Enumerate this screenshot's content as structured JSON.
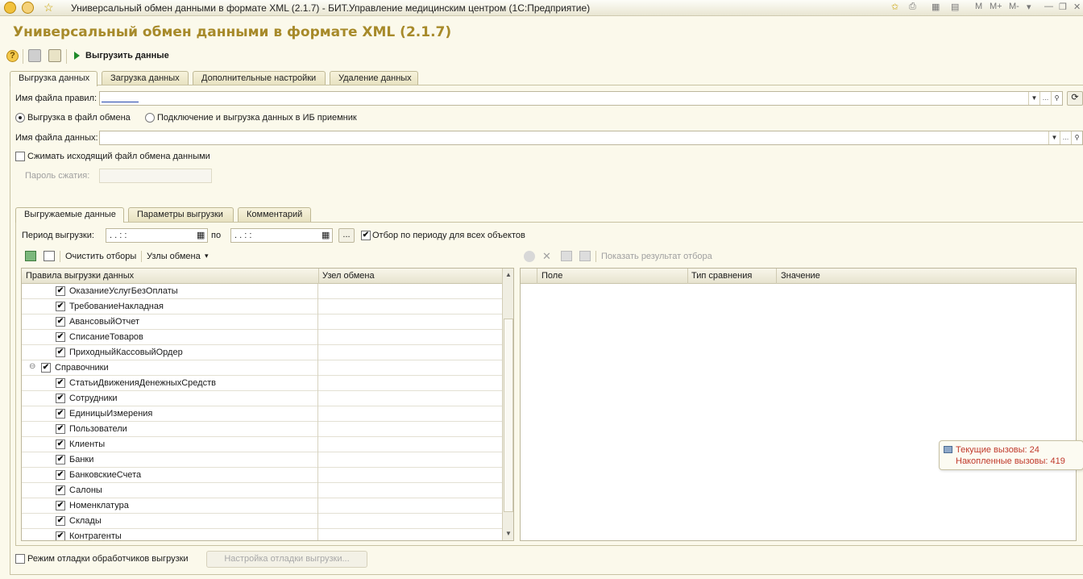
{
  "window": {
    "title": "Универсальный обмен данными в формате XML (2.1.7) - БИТ.Управление медицинским центром  (1С:Предприятие)",
    "right_controls": [
      "M",
      "M+",
      "M-"
    ]
  },
  "form": {
    "heading": "Универсальный обмен данными в формате XML (2.1.7)"
  },
  "toolbar": {
    "export_label": "Выгрузить данные"
  },
  "tabs": [
    {
      "label": "Выгрузка данных"
    },
    {
      "label": "Загрузка данных"
    },
    {
      "label": "Дополнительные настройки"
    },
    {
      "label": "Удаление данных"
    }
  ],
  "export": {
    "rules_file_label": "Имя файла правил:",
    "mode_file_label": "Выгрузка в файл обмена",
    "mode_ib_label": "Подключение и выгрузка данных в ИБ приемник",
    "data_file_label": "Имя файла данных:",
    "compress_label": "Сжимать исходящий файл обмена данными",
    "password_label": "Пароль сжатия:"
  },
  "inner_tabs": [
    {
      "label": "Выгружаемые данные"
    },
    {
      "label": "Параметры выгрузки"
    },
    {
      "label": "Комментарий"
    }
  ],
  "period": {
    "label": "Период выгрузки:",
    "from_value": " .  .      :  :",
    "to_label": "по",
    "to_value": " .  .      :  :",
    "dots_button": "...",
    "all_objects_label": "Отбор по периоду для всех объектов"
  },
  "rules_toolbar": {
    "clear_filters": "Очистить отборы",
    "exchange_nodes": "Узлы обмена"
  },
  "rules_grid": {
    "col_rules": "Правила выгрузки данных",
    "col_node": "Узел обмена",
    "rows": [
      {
        "label": "ОказаниеУслугБезОплаты",
        "level": 2
      },
      {
        "label": "ТребованиеНакладная",
        "level": 2
      },
      {
        "label": "АвансовыйОтчет",
        "level": 2
      },
      {
        "label": "СписаниеТоваров",
        "level": 2
      },
      {
        "label": "ПриходныйКассовыйОрдер",
        "level": 2
      },
      {
        "label": "Справочники",
        "level": 1
      },
      {
        "label": "СтатьиДвиженияДенежныхСредств",
        "level": 2
      },
      {
        "label": "Сотрудники",
        "level": 2
      },
      {
        "label": "ЕдиницыИзмерения",
        "level": 2
      },
      {
        "label": "Пользователи",
        "level": 2
      },
      {
        "label": "Клиенты",
        "level": 2
      },
      {
        "label": "Банки",
        "level": 2
      },
      {
        "label": "БанковскиеСчета",
        "level": 2
      },
      {
        "label": "Салоны",
        "level": 2
      },
      {
        "label": "Номенклатура",
        "level": 2
      },
      {
        "label": "Склады",
        "level": 2
      },
      {
        "label": "Контрагенты",
        "level": 2
      }
    ]
  },
  "filter_toolbar": {
    "show_result": "Показать результат отбора"
  },
  "filter_grid": {
    "col_field": "Поле",
    "col_compare": "Тип сравнения",
    "col_value": "Значение"
  },
  "perf": {
    "current_calls": "Текущие вызовы: 24",
    "accumulated_calls": "Накопленные вызовы: 419"
  },
  "footer": {
    "debug_mode_label": "Режим отладки обработчиков выгрузки",
    "debug_settings_button": "Настройка отладки выгрузки..."
  },
  "colors": {
    "heading": "#a78a2a",
    "background": "#fbf9eb",
    "perf_text": "#c0392b",
    "export_icon": "#1f8a2a"
  }
}
